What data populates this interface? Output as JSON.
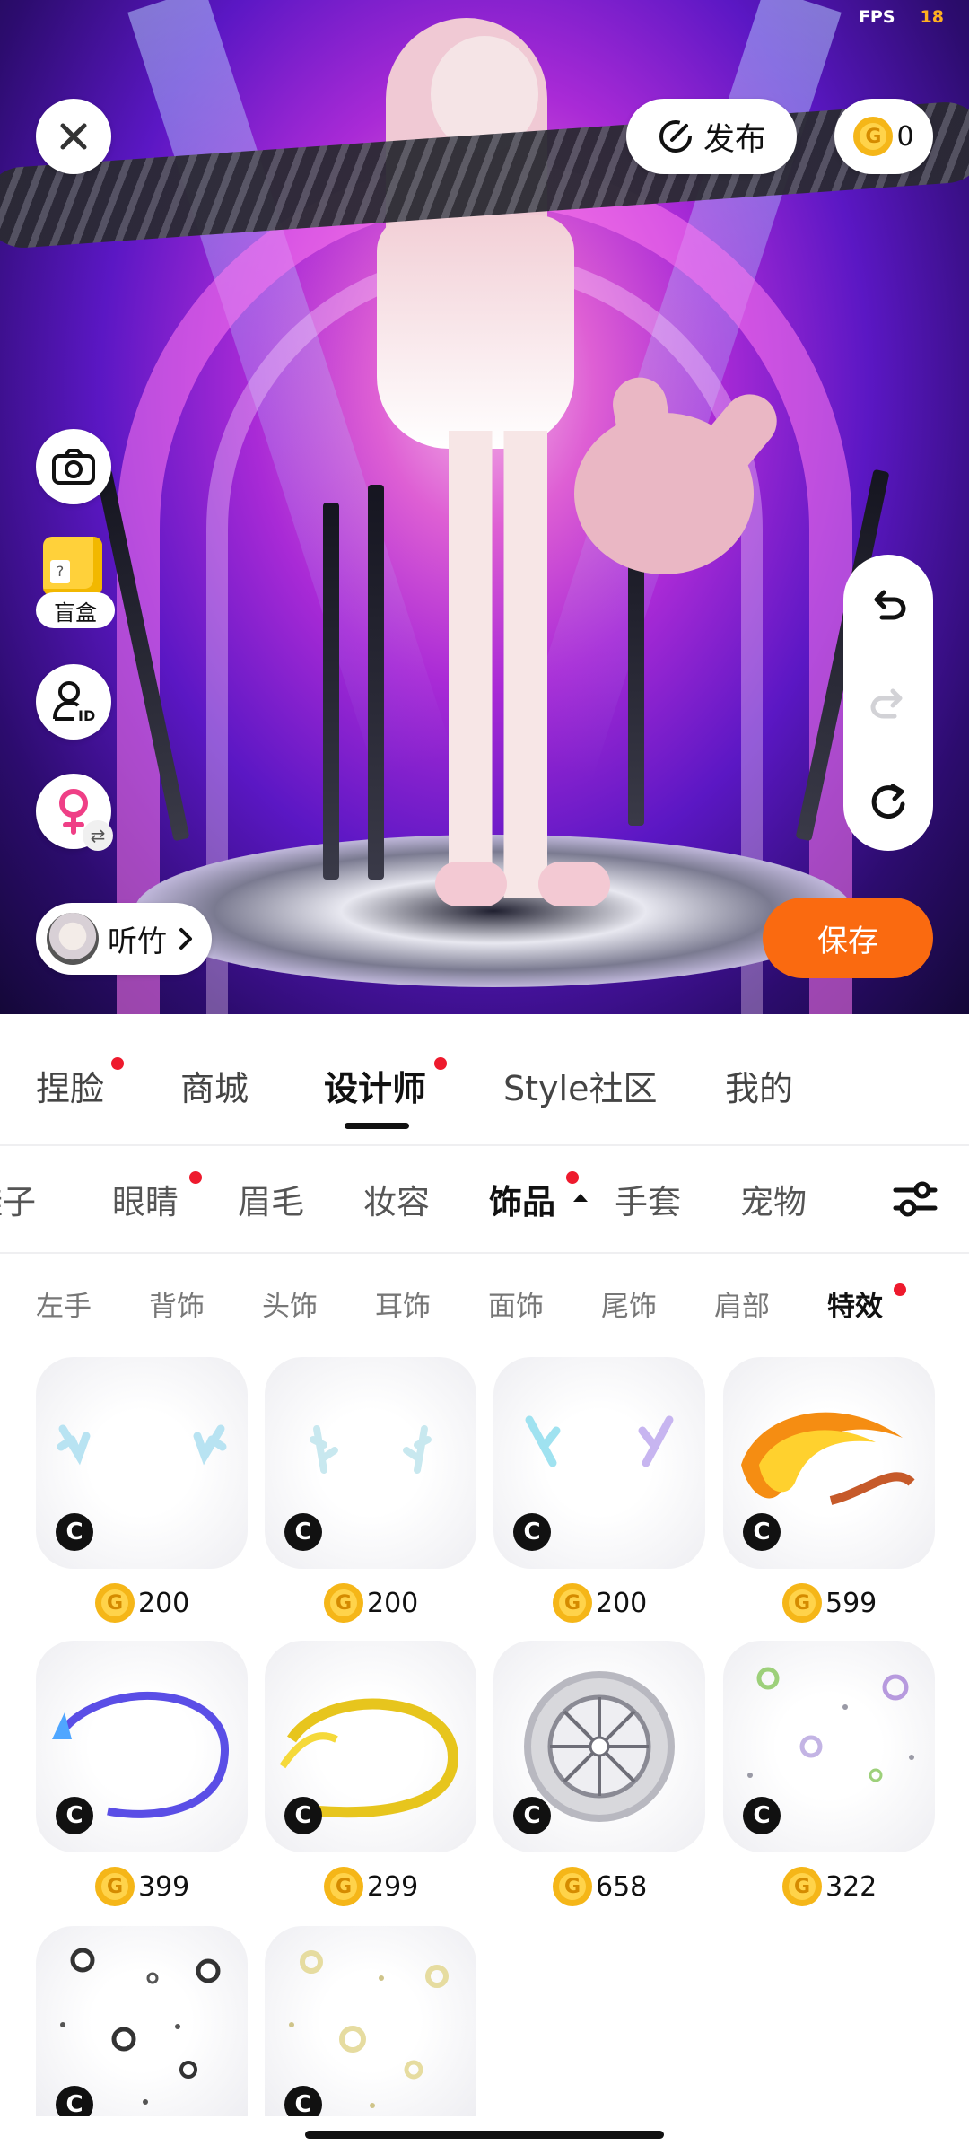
{
  "status": {
    "fps_label": "FPS",
    "fps_value": "18"
  },
  "toolbar": {
    "publish_label": "发布",
    "coin_balance": "0"
  },
  "side_tools": {
    "blind_box_label": "盲盒"
  },
  "profile": {
    "name": "听竹"
  },
  "actions": {
    "save_label": "保存"
  },
  "main_tabs": [
    {
      "label": "捏脸",
      "dot": true
    },
    {
      "label": "商城",
      "dot": false
    },
    {
      "label": "设计师",
      "dot": true,
      "active": true
    },
    {
      "label": "Style社区",
      "dot": false
    },
    {
      "label": "我的",
      "dot": false
    }
  ],
  "category_tabs": [
    {
      "label": "鞋子"
    },
    {
      "label": "眼睛",
      "dot": true
    },
    {
      "label": "眉毛"
    },
    {
      "label": "妆容"
    },
    {
      "label": "饰品",
      "dot": true,
      "active": true
    },
    {
      "label": "手套"
    },
    {
      "label": "宠物"
    }
  ],
  "sub_tabs": [
    {
      "label": "左手"
    },
    {
      "label": "背饰"
    },
    {
      "label": "头饰"
    },
    {
      "label": "耳饰"
    },
    {
      "label": "面饰"
    },
    {
      "label": "尾饰"
    },
    {
      "label": "肩部"
    },
    {
      "label": "特效",
      "dot": true,
      "active": true
    }
  ],
  "items": [
    {
      "price": "200",
      "art": "antlers-blue-1"
    },
    {
      "price": "200",
      "art": "antlers-blue-2"
    },
    {
      "price": "200",
      "art": "antlers-iridescent"
    },
    {
      "price": "599",
      "art": "fire-swirl"
    },
    {
      "price": "399",
      "art": "blue-ring-trail"
    },
    {
      "price": "299",
      "art": "gold-ring-trail"
    },
    {
      "price": "658",
      "art": "silver-dial"
    },
    {
      "price": "322",
      "art": "floating-bubbles"
    },
    {
      "price": "",
      "art": "dark-bubbles"
    },
    {
      "price": "",
      "art": "gold-bubbles"
    }
  ],
  "badge_letter": "C",
  "coin_letter": "G",
  "colors": {
    "accent_orange": "#fa6a10",
    "notification_red": "#ee1a2d",
    "coin_gold": "#f5b618"
  }
}
